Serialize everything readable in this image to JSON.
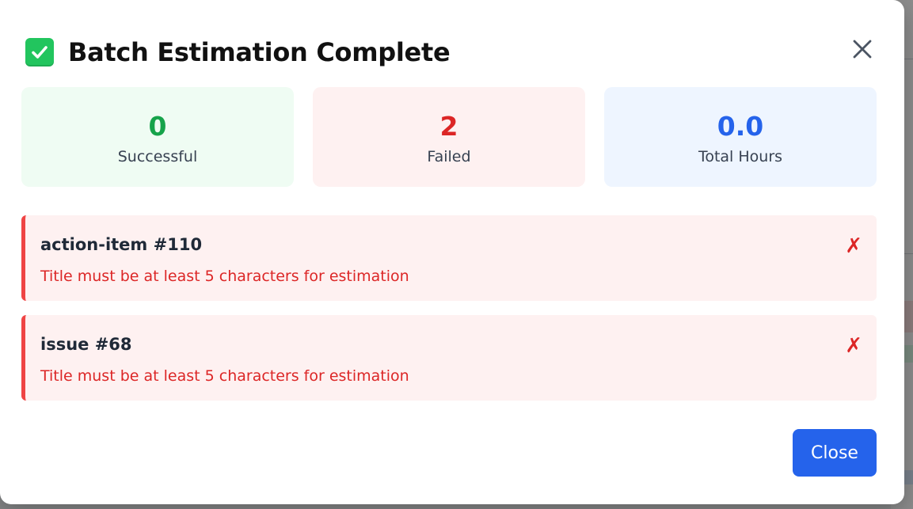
{
  "modal": {
    "title": "Batch Estimation Complete",
    "close_icon": "close-icon",
    "title_icon": "check-mark-button-icon"
  },
  "stats": {
    "successful": {
      "value": "0",
      "label": "Successful",
      "color": "#16a34a"
    },
    "failed": {
      "value": "2",
      "label": "Failed",
      "color": "#dc2626"
    },
    "total_hours": {
      "value": "0.0",
      "label": "Total Hours",
      "color": "#2563eb"
    }
  },
  "results": [
    {
      "title": "action-item #110",
      "error": "Title must be at least 5 characters for estimation",
      "status": "✗"
    },
    {
      "title": "issue #68",
      "error": "Title must be at least 5 characters for estimation",
      "status": "✗"
    }
  ],
  "footer": {
    "close_label": "Close"
  },
  "colors": {
    "accent": "#2563eb",
    "error": "#dc2626",
    "success": "#16a34a"
  }
}
